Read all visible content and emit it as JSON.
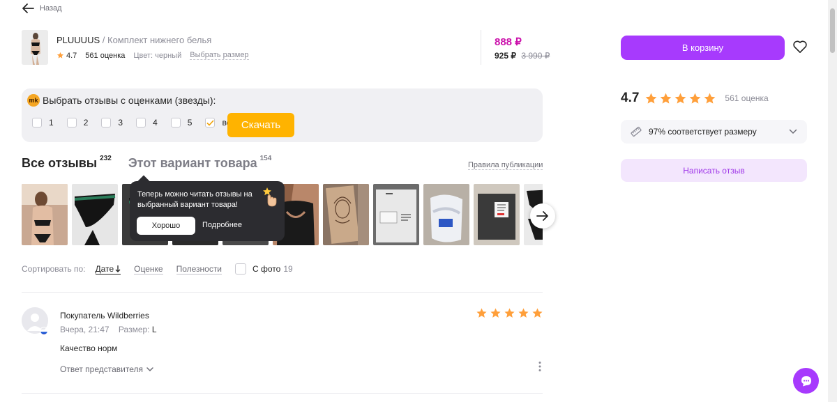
{
  "nav": {
    "back_label": "Назад"
  },
  "product": {
    "brand": "PLUUUUS",
    "separator": "/",
    "name": "Комплект нижнего белья",
    "rating": "4.7",
    "rating_count": "561 оценка",
    "color": "Цвет: черный",
    "size_link": "Выбрать размер",
    "price": "888 ₽",
    "price_wallet": "925 ₽",
    "price_old": "3 990 ₽"
  },
  "actions": {
    "cart_label": "В корзину",
    "write_review_label": "Написать отзыв"
  },
  "summary": {
    "rating": "4.7",
    "stars": 5,
    "count": "561 оценка",
    "fit_text": "97% соответствует размеру"
  },
  "filter": {
    "badge": "mk",
    "title": "Выбрать отзывы с оценками (звезды):",
    "options": [
      {
        "label": "1",
        "checked": false
      },
      {
        "label": "2",
        "checked": false
      },
      {
        "label": "3",
        "checked": false
      },
      {
        "label": "4",
        "checked": false
      },
      {
        "label": "5",
        "checked": false
      },
      {
        "label": "все",
        "checked": true
      }
    ],
    "download_label": "Скачать"
  },
  "tabs": {
    "all_label": "Все отзывы",
    "all_count": "232",
    "variant_label": "Этот вариант товара",
    "variant_count": "154",
    "rules_link": "Правила публикации"
  },
  "tooltip": {
    "message": "Теперь можно читать отзывы на выбранный вариант товара!",
    "ok_label": "Хорошо",
    "more_label": "Подробнее"
  },
  "sort": {
    "label": "Сортировать по:",
    "options": [
      {
        "label": "Дате",
        "active": true
      },
      {
        "label": "Оценке",
        "active": false
      },
      {
        "label": "Полезности",
        "active": false
      }
    ],
    "photo_label": "С фото",
    "photo_count": "19"
  },
  "review": {
    "author": "Покупатель Wildberries",
    "date": "Вчера, 21:47",
    "size_label": "Размер:",
    "size_value": "L",
    "stars": 5,
    "text": "Качество норм",
    "reply_label": "Ответ представителя"
  },
  "colors": {
    "accent": "#a73afd",
    "price": "#cb11ab",
    "star": "#ff9f3a",
    "download": "#ffb300"
  }
}
